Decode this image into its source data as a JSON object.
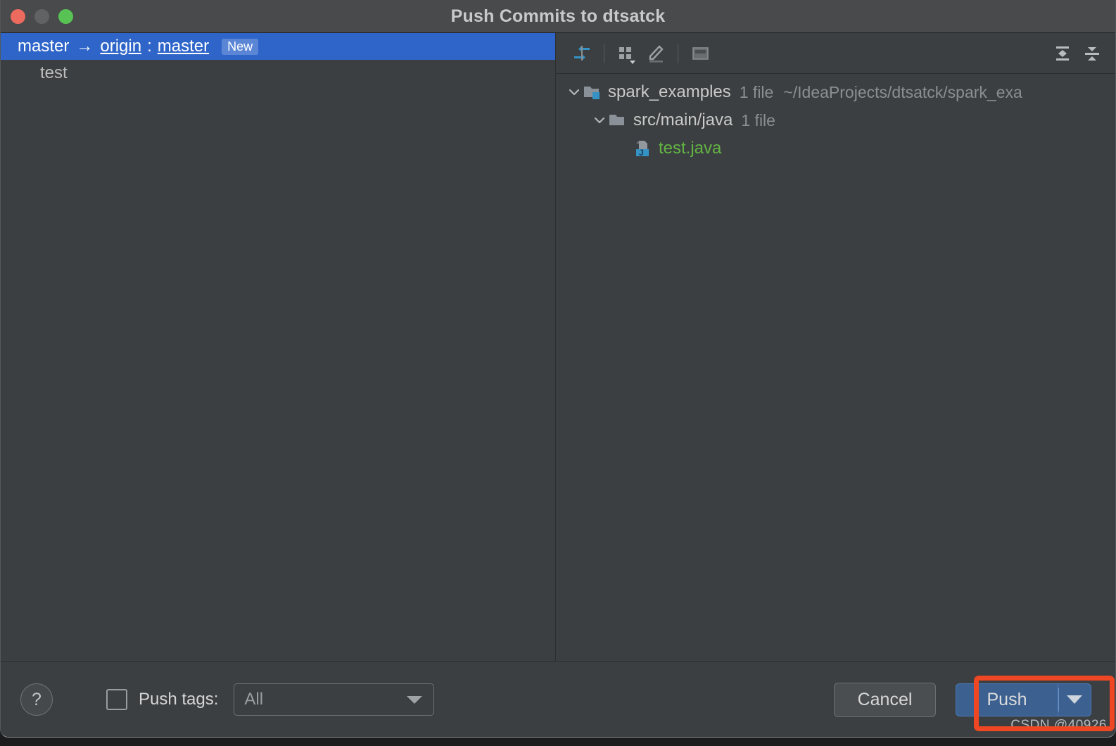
{
  "window": {
    "title": "Push Commits to dtsatck",
    "traffic_lights": [
      "close-red",
      "minimize-gray",
      "zoom-green"
    ]
  },
  "commits_pane": {
    "branch_row": {
      "local_branch": "master",
      "arrow": "→",
      "remote": "origin",
      "separator": ":",
      "remote_branch": "master",
      "badge": "New"
    },
    "commits": [
      {
        "message": "test"
      }
    ]
  },
  "changes_pane": {
    "toolbar": {
      "buttons": [
        {
          "name": "expand-collapse-diff-icon",
          "label": "Collapse diff"
        },
        {
          "name": "group-by-icon",
          "label": "Group By"
        },
        {
          "name": "edit-source-icon",
          "label": "Edit Source"
        },
        {
          "name": "preview-diff-icon",
          "label": "Preview Diff"
        },
        {
          "name": "expand-all-icon",
          "label": "Expand All"
        },
        {
          "name": "collapse-all-icon",
          "label": "Collapse All"
        }
      ]
    },
    "tree": [
      {
        "icon": "module-folder-icon",
        "name": "spark_examples",
        "meta": "1 file",
        "path": "~/IdeaProjects/dtsatck/spark_exa",
        "expanded": true,
        "indent": 0,
        "kind": "module"
      },
      {
        "icon": "folder-icon",
        "name": "src/main/java",
        "meta": "1 file",
        "path": "",
        "expanded": true,
        "indent": 1,
        "kind": "folder"
      },
      {
        "icon": "java-file-icon",
        "name": "test.java",
        "meta": "",
        "path": "",
        "expanded": null,
        "indent": 2,
        "kind": "file"
      }
    ]
  },
  "bottom_bar": {
    "help_label": "?",
    "push_tags_checked": false,
    "push_tags_label": "Push tags:",
    "tags_value": "All",
    "cancel_label": "Cancel",
    "push_label": "Push"
  },
  "annotation": {
    "watermark": "CSDN @40926",
    "highlight_color": "#ef4623"
  },
  "colors": {
    "window_bg": "#3c3f41",
    "titlebar_bg": "#484a4c",
    "selection_blue": "#2f65c9",
    "accent_blue": "#3c6090",
    "file_green": "#62b543",
    "icon_blue": "#3592c4"
  }
}
